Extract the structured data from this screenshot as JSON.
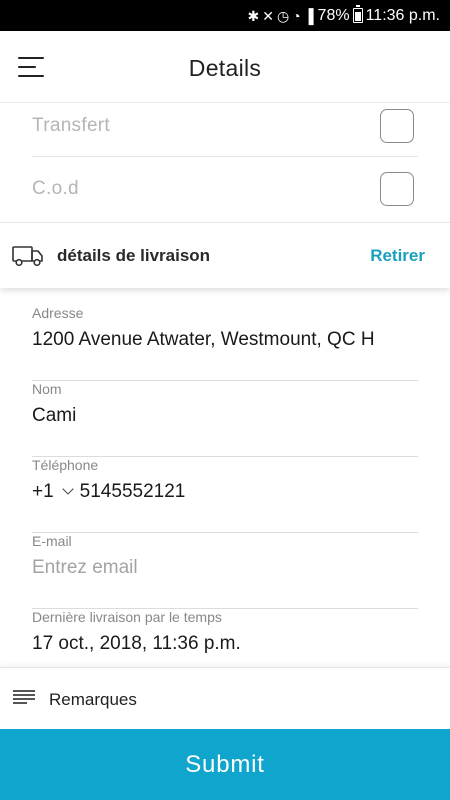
{
  "status_bar": {
    "battery": "78%",
    "time": "11:36 p.m.",
    "icons": [
      "bluetooth-icon",
      "mute-icon",
      "alarm-icon",
      "wifi-icon",
      "signal-icon",
      "battery-icon"
    ]
  },
  "header": {
    "title": "Details",
    "menu_icon": "hamburger-menu-icon"
  },
  "payment_options": [
    {
      "label": "Transfert",
      "checked": false
    },
    {
      "label": "C.o.d",
      "checked": false
    }
  ],
  "delivery_section": {
    "icon": "truck-icon",
    "title": "détails de livraison",
    "action_label": "Retirer",
    "accent_color": "#1aa0bf"
  },
  "fields": {
    "address": {
      "label": "Adresse",
      "value": "1200 Avenue Atwater, Westmount, QC H"
    },
    "name": {
      "label": "Nom",
      "value": "Cami"
    },
    "phone": {
      "label": "Téléphone",
      "country_code": "+1",
      "number": "5145552121"
    },
    "email": {
      "label": "E-mail",
      "placeholder": "Entrez email",
      "value": ""
    },
    "last_delivery": {
      "label": "Dernière livraison par le temps",
      "value": "17 oct., 2018, 11:36 p.m."
    }
  },
  "remarks": {
    "icon": "notes-icon",
    "label": "Remarques"
  },
  "submit": {
    "label": "Submit",
    "color": "#0fa5cc"
  }
}
